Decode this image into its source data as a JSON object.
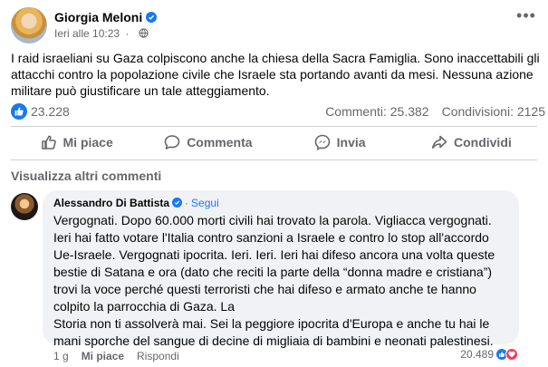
{
  "post": {
    "author": "Giorgia Meloni",
    "time": "Ieri alle 10:23",
    "text": "I raid israeliani su Gaza colpiscono anche la chiesa della Sacra Famiglia. Sono inaccettabili gli attacchi contro la popolazione civile che Israele sta portando avanti da mesi. Nessuna azione militare può giustificare un tale atteggiamento.",
    "reactions": "23.228",
    "comments": "Commenti: 25.382",
    "shares": "Condivisioni: 2125"
  },
  "actions": {
    "like": "Mi piace",
    "comment": "Commenta",
    "send": "Invia",
    "share": "Condividi"
  },
  "more_comments": "Visualizza altri commenti",
  "comment": {
    "author": "Alessandro Di Battista",
    "separator": "·",
    "follow": "Segui",
    "text": "Vergognati. Dopo 60.000 morti civili hai trovato la parola. Vigliacca vergognati. Ieri hai fatto votare l'Italia contro sanzioni a Israele e contro lo stop all'accordo Ue-Israele. Vergognati ipocrita. Ieri. Ieri. Ieri hai difeso ancora una volta queste bestie di Satana e ora (dato che reciti la parte della “donna madre e cristiana”) trovi la voce perché questi terroristi che hai difeso e armato anche te hanno colpito la parrocchia di Gaza. La",
    "text2": "Storia non ti assolverà mai. Sei la peggiore ipocrita d'Europa e anche tu hai le mani sporche del sangue di decine di migliaia di bambini e neonati palestinesi.",
    "time": "1 g",
    "like": "Mi piace",
    "reply": "Rispondi",
    "reactions": "20.489"
  },
  "icons": {
    "verified": "verified-badge-icon",
    "globe": "globe-icon",
    "more": "more-options-icon",
    "like": "thumbs-up-icon",
    "comment": "comment-icon",
    "send": "messenger-icon",
    "share": "share-icon",
    "love": "heart-icon"
  },
  "colors": {
    "accent": "#1877f2",
    "love": "#f33e58",
    "secondary_text": "#65676b",
    "bubble": "#f0f2f5"
  }
}
